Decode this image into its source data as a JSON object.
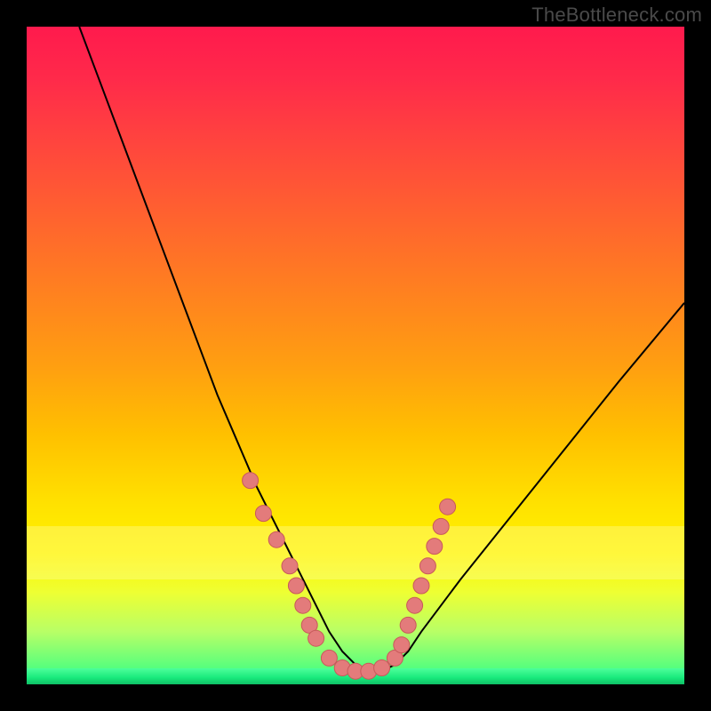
{
  "watermark": "TheBottleneck.com",
  "colors": {
    "marker": "#e37b7b",
    "marker_stroke": "#c85a5a",
    "curve": "#000000",
    "gradient_top": "#ff1a4d",
    "gradient_bottom": "#2aff88",
    "frame": "#000000"
  },
  "chart_data": {
    "type": "line",
    "title": "",
    "xlabel": "",
    "ylabel": "",
    "xlim": [
      0,
      100
    ],
    "ylim": [
      0,
      100
    ],
    "grid": false,
    "legend": false,
    "series": [
      {
        "name": "bottleneck-curve",
        "x": [
          8,
          11,
          14,
          17,
          20,
          23,
          26,
          29,
          32,
          35,
          38,
          40,
          42,
          44,
          46,
          48,
          50,
          52,
          54,
          56,
          58,
          60,
          63,
          66,
          70,
          74,
          78,
          82,
          86,
          90,
          95,
          100
        ],
        "y": [
          100,
          92,
          84,
          76,
          68,
          60,
          52,
          44,
          37,
          30,
          24,
          20,
          16,
          12,
          8,
          5,
          3,
          2,
          2,
          3,
          5,
          8,
          12,
          16,
          21,
          26,
          31,
          36,
          41,
          46,
          52,
          58
        ]
      }
    ],
    "markers": {
      "name": "highlighted-points",
      "points": [
        {
          "x": 34,
          "y": 31
        },
        {
          "x": 36,
          "y": 26
        },
        {
          "x": 38,
          "y": 22
        },
        {
          "x": 40,
          "y": 18
        },
        {
          "x": 41,
          "y": 15
        },
        {
          "x": 42,
          "y": 12
        },
        {
          "x": 43,
          "y": 9
        },
        {
          "x": 44,
          "y": 7
        },
        {
          "x": 46,
          "y": 4
        },
        {
          "x": 48,
          "y": 2.5
        },
        {
          "x": 50,
          "y": 2
        },
        {
          "x": 52,
          "y": 2
        },
        {
          "x": 54,
          "y": 2.5
        },
        {
          "x": 56,
          "y": 4
        },
        {
          "x": 57,
          "y": 6
        },
        {
          "x": 58,
          "y": 9
        },
        {
          "x": 59,
          "y": 12
        },
        {
          "x": 60,
          "y": 15
        },
        {
          "x": 61,
          "y": 18
        },
        {
          "x": 62,
          "y": 21
        },
        {
          "x": 63,
          "y": 24
        },
        {
          "x": 64,
          "y": 27
        }
      ]
    },
    "bands": [
      {
        "name": "pale-yellow-band",
        "y0": 16,
        "y1": 24,
        "color": "rgba(255,255,170,0.35)"
      }
    ]
  }
}
